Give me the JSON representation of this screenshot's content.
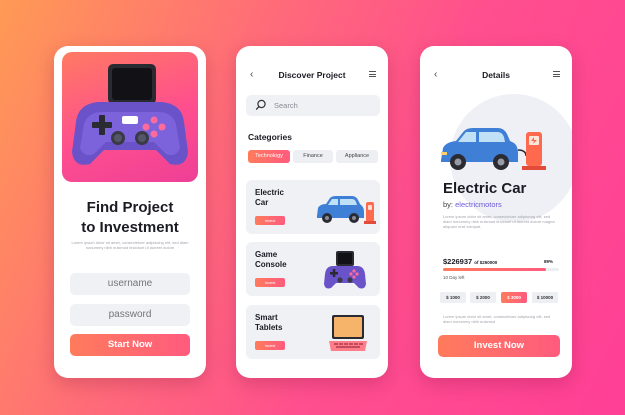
{
  "login": {
    "title_line1": "Find Project",
    "title_line2": "to Investment",
    "description": "Lorem ipsum dolor sit amet, consectetuer adipiscing elit, sed diam nonummy nibh euismod tincidunt ut laoreet dolore",
    "username_placeholder": "username",
    "password_placeholder": "password",
    "start_label": "Start Now"
  },
  "discover": {
    "back_icon": "chevron-left-icon",
    "title": "Discover Project",
    "menu_icon": "hamburger-menu-icon",
    "search_placeholder": "Search",
    "categories_title": "Categories",
    "categories": [
      {
        "label": "Technology",
        "active": true
      },
      {
        "label": "Finance",
        "active": false
      },
      {
        "label": "Appliance",
        "active": false
      }
    ],
    "projects": [
      {
        "title_line1": "Electric",
        "title_line2": "Car",
        "button": "Invest",
        "icon": "electric-car-icon"
      },
      {
        "title_line1": "Game",
        "title_line2": "Console",
        "button": "Invest",
        "icon": "game-console-icon"
      },
      {
        "title_line1": "Smart",
        "title_line2": "Tablets",
        "button": "Invest",
        "icon": "laptop-icon"
      }
    ]
  },
  "details": {
    "back_icon": "chevron-left-icon",
    "title": "Details",
    "menu_icon": "hamburger-menu-icon",
    "project_title": "Electric Car",
    "by_prefix": "by:",
    "author": "electricmotors",
    "description": "Lorem ipsum dolor sit amet, consectetuer adipiscing elit, sed diam nonummy nibh euismod tincidunt ut laoreet dolore magna aliquam erat volutpat.",
    "raised": "$226937",
    "goal": "of $250000",
    "progress_label": "89%",
    "progress_value": 0.89,
    "days_left": "10 Day left",
    "amounts": [
      {
        "label": "$ 1000",
        "active": false
      },
      {
        "label": "$ 2000",
        "active": false
      },
      {
        "label": "$ 3000",
        "active": true
      },
      {
        "label": "$ 10000",
        "active": false
      }
    ],
    "footer_text": "Lorem ipsum dolor sit amet, consectetuer adipiscing elit, sed diam nonummy nibh euismod",
    "invest_label": "Invest Now"
  },
  "colors": {
    "accent_start": "#ff7b5c",
    "accent_end": "#ff5b7e",
    "car_blue": "#3f7fd6",
    "console_purple": "#6a52c9"
  }
}
